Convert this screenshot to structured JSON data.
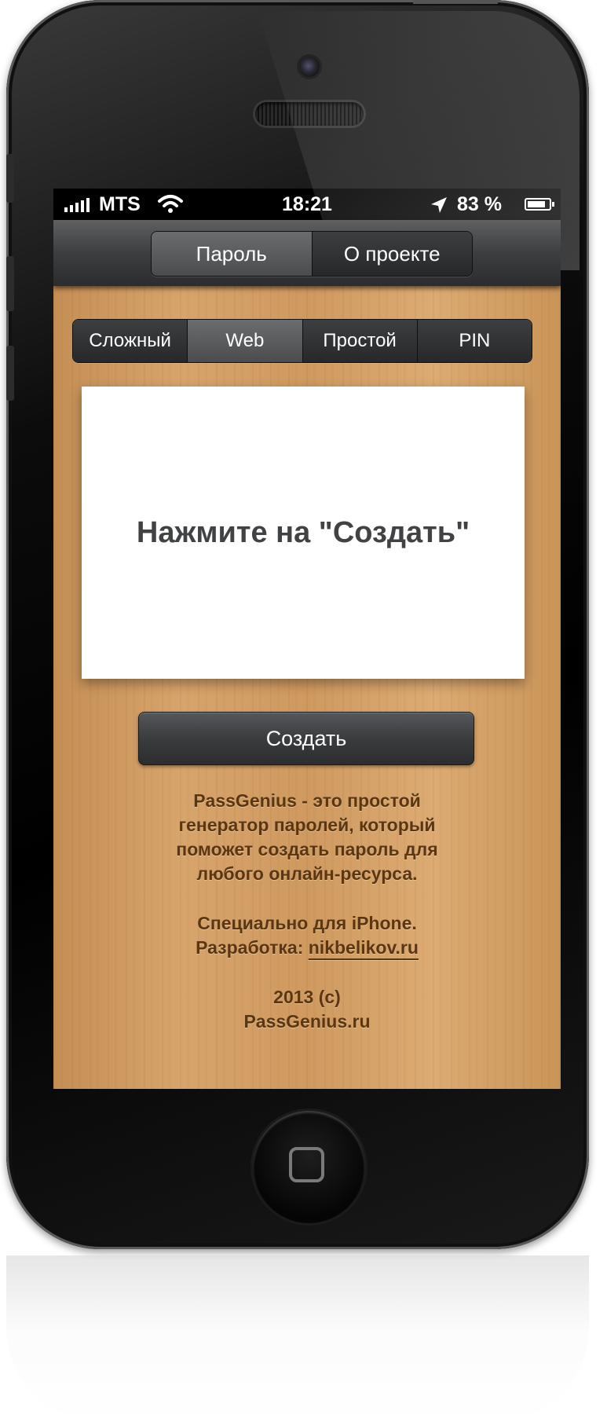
{
  "status_bar": {
    "carrier": "MTS",
    "time": "18:21",
    "battery_percent": "83 %",
    "battery_level": 0.83,
    "icons": [
      "signal-icon",
      "wifi-icon",
      "location-arrow-icon",
      "battery-icon"
    ]
  },
  "nav": {
    "tabs": [
      {
        "label": "Пароль",
        "selected": true
      },
      {
        "label": "О проекте",
        "selected": false
      }
    ]
  },
  "modes": {
    "options": [
      {
        "label": "Сложный",
        "selected": false
      },
      {
        "label": "Web",
        "selected": true
      },
      {
        "label": "Простой",
        "selected": false
      },
      {
        "label": "PIN",
        "selected": false
      }
    ]
  },
  "result": {
    "text": "Нажмите на \"Создать\""
  },
  "create_button": {
    "label": "Создать"
  },
  "about": {
    "description_lines": [
      "PassGenius - это простой",
      "генератор паролей, который",
      "поможет создать пароль для",
      "любого онлайн-ресурса."
    ],
    "made_for": "Специально для iPhone.",
    "dev_prefix": "Разработка: ",
    "dev_link": "nikbelikov.ru",
    "year": "2013 (c)",
    "site": "PassGenius.ru"
  },
  "colors": {
    "wood": "#d0a066",
    "about_text": "#5a3612",
    "result_text": "#414244",
    "nav_bar": "#3c3e40"
  }
}
